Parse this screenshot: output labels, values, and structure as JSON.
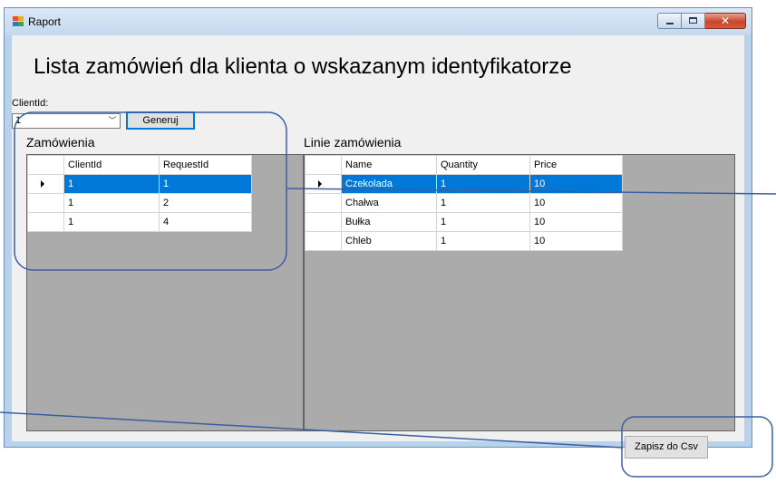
{
  "window": {
    "title": "Raport",
    "icon": "app-icon",
    "caption_buttons": [
      "minimize-icon",
      "maximize-icon",
      "close-icon"
    ]
  },
  "main": {
    "title": "Lista zamówień dla klienta o wskazanym identyfikatorze",
    "client_id_label": "ClientId:",
    "client_id_value": "1",
    "generate_button": "Generuj",
    "save_csv_button": "Zapisz do Csv"
  },
  "orders": {
    "label": "Zamówienia",
    "columns": [
      "ClientId",
      "RequestId"
    ],
    "rows": [
      [
        "1",
        "1"
      ],
      [
        "1",
        "2"
      ],
      [
        "1",
        "4"
      ]
    ],
    "selected_row": 0
  },
  "lines": {
    "label": "Linie zamówienia",
    "columns": [
      "Name",
      "Quantity",
      "Price"
    ],
    "rows": [
      [
        "Czekolada",
        "1",
        "10"
      ],
      [
        "Chałwa",
        "1",
        "10"
      ],
      [
        "Bułka",
        "1",
        "10"
      ],
      [
        "Chleb",
        "1",
        "10"
      ]
    ],
    "selected_row": 0
  },
  "colors": {
    "selection": "#0078d7",
    "annotation": "#3a5fa0",
    "grid_background": "#ababab"
  }
}
